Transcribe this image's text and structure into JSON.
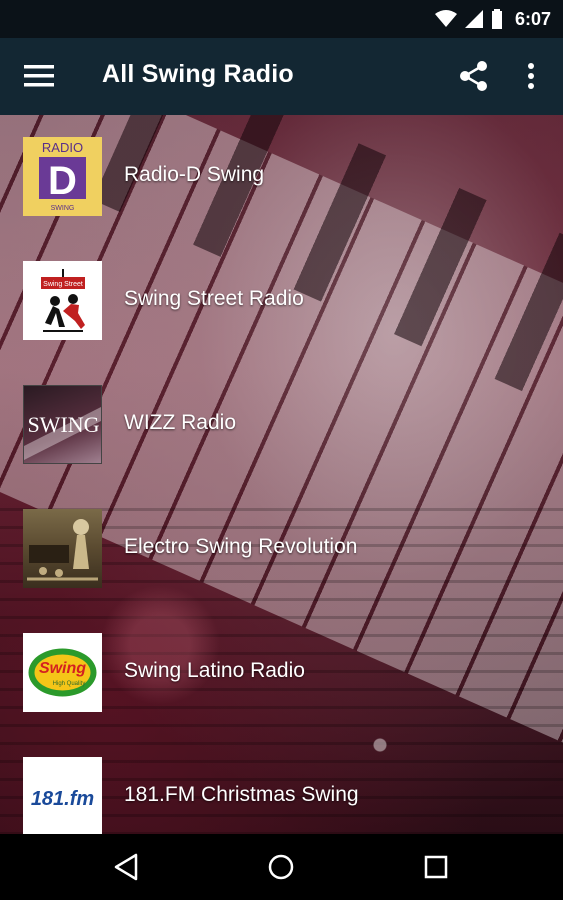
{
  "status_bar": {
    "time": "6:07"
  },
  "app_bar": {
    "title": "All Swing Radio"
  },
  "stations": [
    {
      "name": "Radio-D Swing",
      "logo_text_top": "RADIO",
      "logo_letter": "D",
      "logo_text_bottom": "SWING"
    },
    {
      "name": "Swing Street Radio",
      "logo_text": "Swing Street"
    },
    {
      "name": "WIZZ Radio",
      "logo_text": "SWING"
    },
    {
      "name": "Electro Swing Revolution"
    },
    {
      "name": "Swing Latino Radio",
      "logo_text": "Swing",
      "logo_tag": "High Quality"
    },
    {
      "name": "181.FM Christmas Swing",
      "logo_text": "181.fm"
    }
  ],
  "colors": {
    "status_bar": "#0b1218",
    "app_bar": "#132733",
    "accent_yellow": "#f0d060",
    "radio_d_purple": "#6a3a96"
  }
}
